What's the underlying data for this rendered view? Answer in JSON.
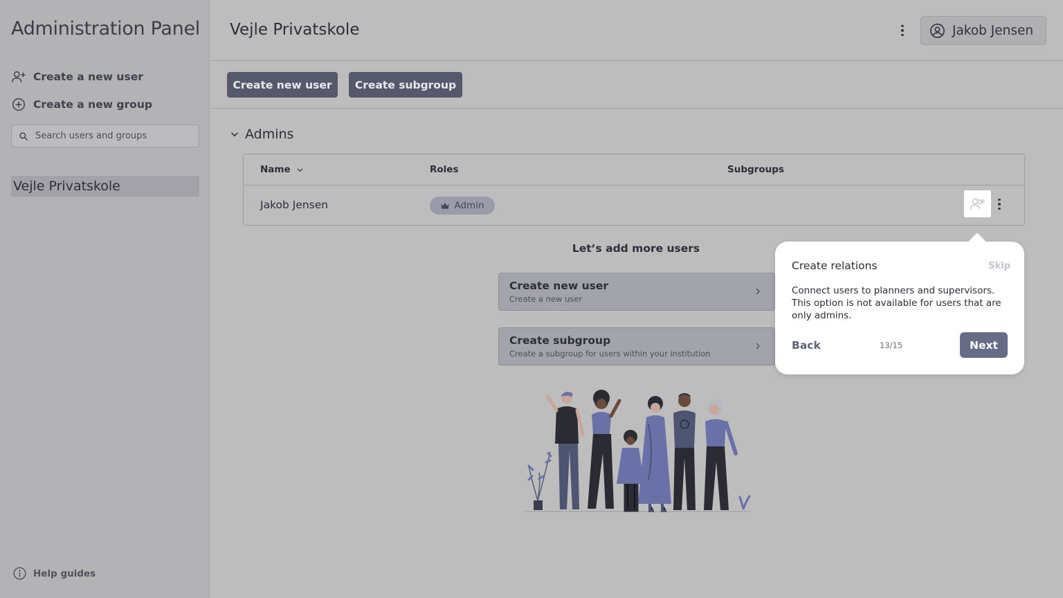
{
  "sidebar": {
    "app_title": "Administration Panel",
    "actions": [
      {
        "label": "Create a new user",
        "icon": "add-user-icon"
      },
      {
        "label": "Create a new group",
        "icon": "plus-circle-icon"
      }
    ],
    "search": {
      "placeholder": "Search users and groups",
      "value": ""
    },
    "tree": [
      {
        "label": "Vejle Privatskole",
        "selected": true
      }
    ],
    "help": {
      "label": "Help guides",
      "icon": "info-icon"
    }
  },
  "header": {
    "title": "Vejle Privatskole",
    "user": {
      "name": "Jakob Jensen",
      "icon": "user-circle-icon"
    }
  },
  "toolbar": {
    "create_user_label": "Create new user",
    "create_subgroup_label": "Create subgroup"
  },
  "section": {
    "title": "Admins",
    "expanded": true
  },
  "table": {
    "columns": [
      "Name",
      "Roles",
      "Subgroups"
    ],
    "rows": [
      {
        "name": "Jakob Jensen",
        "role": "Admin",
        "subgroups": ""
      }
    ]
  },
  "empty_state": {
    "heading": "Let’s add more users",
    "cards": [
      {
        "title": "Create new user",
        "subtitle": "Create a new user"
      },
      {
        "title": "Create subgroup",
        "subtitle": "Create a subgroup for users within your institution"
      }
    ]
  },
  "tour": {
    "title": "Create relations",
    "skip": "Skip",
    "body": "Connect users to planners and supervisors. This option is not available for users that are only admins.",
    "back": "Back",
    "step": "13/15",
    "next": "Next"
  },
  "colors": {
    "primary_button": "#55596b",
    "tour_next": "#666b86",
    "sidebar_bg": "#b3b3b5",
    "main_bg": "#bdbdbd",
    "chip_bg": "#9a9cab"
  }
}
